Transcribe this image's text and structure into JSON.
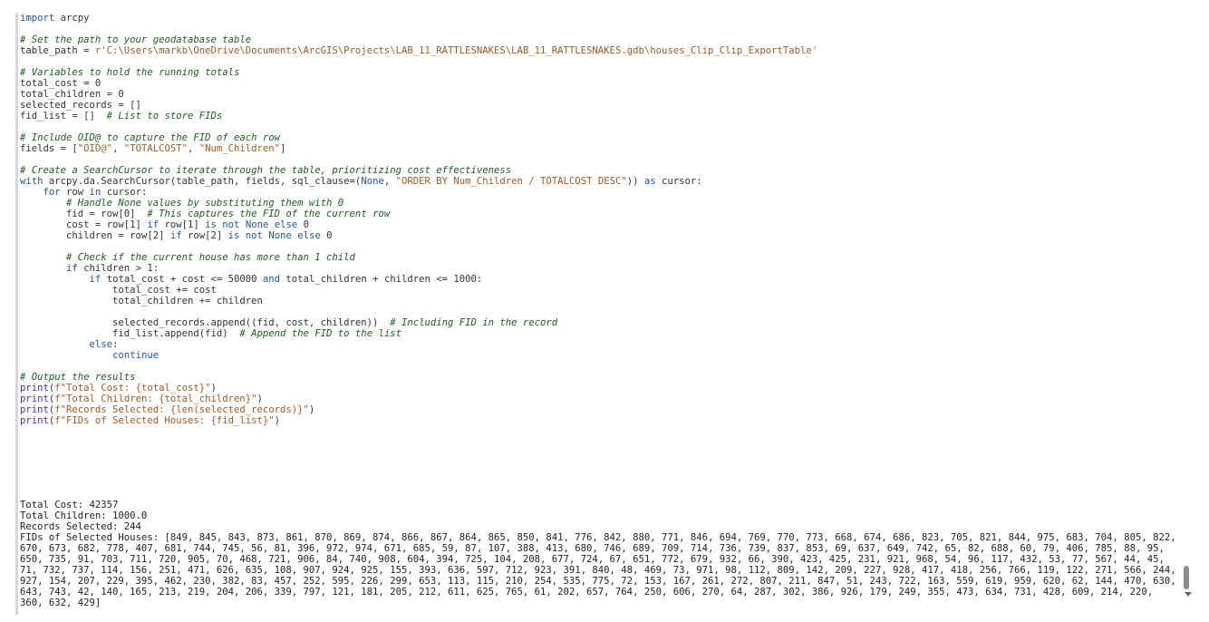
{
  "code": {
    "lines": [
      "import arcpy",
      "",
      "# Set the path to your geodatabase table",
      "table_path = r'C:\\Users\\markb\\OneDrive\\Documents\\ArcGIS\\Projects\\LAB_11_RATTLESNAKES\\LAB_11_RATTLESNAKES.gdb\\houses_Clip_Clip_ExportTable'",
      "",
      "# Variables to hold the running totals",
      "total_cost = 0",
      "total_children = 0",
      "selected_records = []",
      "fid_list = []  # List to store FIDs",
      "",
      "# Include OID@ to capture the FID of each row",
      "fields = [\"OID@\", \"TOTALCOST\", \"Num_Children\"]",
      "",
      "# Create a SearchCursor to iterate through the table, prioritizing cost effectiveness",
      "with arcpy.da.SearchCursor(table_path, fields, sql_clause=(None, \"ORDER BY Num_Children / TOTALCOST DESC\")) as cursor:",
      "    for row in cursor:",
      "        # Handle None values by substituting them with 0",
      "        fid = row[0]  # This captures the FID of the current row",
      "        cost = row[1] if row[1] is not None else 0",
      "        children = row[2] if row[2] is not None else 0",
      "",
      "        # Check if the current house has more than 1 child",
      "        if children > 1:",
      "            if total_cost + cost <= 50000 and total_children + children <= 1000:",
      "                total_cost += cost",
      "                total_children += children",
      "",
      "                selected_records.append((fid, cost, children))  # Including FID in the record",
      "                fid_list.append(fid)  # Append the FID to the list",
      "            else:",
      "                continue",
      "",
      "# Output the results",
      "print(f\"Total Cost: {total_cost}\")",
      "print(f\"Total Children: {total_children}\")",
      "print(f\"Records Selected: {len(selected_records)}\")",
      "print(f\"FIDs of Selected Houses: {fid_list}\")"
    ]
  },
  "output": {
    "lines": [
      "Total Cost: 42357",
      "Total Children: 1000.0",
      "Records Selected: 244",
      "FIDs of Selected Houses: [849, 845, 843, 873, 861, 870, 869, 874, 866, 867, 864, 865, 850, 841, 776, 842, 880, 771, 846, 694, 769, 770, 773, 668, 674, 686, 823, 705, 821, 844, 975, 683, 704, 805, 822, 670, 673, 682, 778, 407, 681, 744, 745, 56, 81, 396, 972, 974, 671, 685, 59, 87, 107, 388, 413, 680, 746, 689, 709, 714, 736, 739, 837, 853, 69, 637, 649, 742, 65, 82, 688, 60, 79, 406, 785, 88, 95, 650, 735, 91, 703, 711, 720, 905, 70, 468, 721, 906, 84, 740, 908, 604, 394, 725, 104, 208, 677, 724, 67, 651, 772, 679, 932, 66, 390, 423, 425, 231, 921, 968, 54, 96, 117, 432, 53, 77, 567, 44, 45, 71, 732, 737, 114, 156, 251, 471, 626, 635, 108, 907, 924, 925, 155, 393, 636, 597, 712, 923, 391, 840, 48, 469, 73, 971, 98, 112, 809, 142, 209, 227, 928, 417, 418, 256, 766, 119, 122, 271, 566, 244, 927, 154, 207, 229, 395, 462, 230, 382, 83, 457, 252, 595, 226, 299, 653, 113, 115, 210, 254, 535, 775, 72, 153, 167, 261, 272, 807, 211, 847, 51, 243, 722, 163, 559, 619, 959, 620, 62, 144, 470, 630, 643, 743, 42, 140, 165, 213, 219, 204, 206, 339, 797, 121, 181, 205, 212, 611, 625, 765, 61, 202, 657, 764, 250, 606, 270, 64, 287, 302, 386, 926, 179, 249, 355, 473, 634, 731, 428, 609, 214, 220, 360, 632, 429]"
    ]
  },
  "colors": {
    "comment": "#1d5e1d",
    "keyword": "#1f56a8",
    "string": "#a35b22",
    "builtin": "#5a2aa2",
    "text": "#333333"
  },
  "icons": {
    "scroll_down": "chevron-down-icon"
  }
}
